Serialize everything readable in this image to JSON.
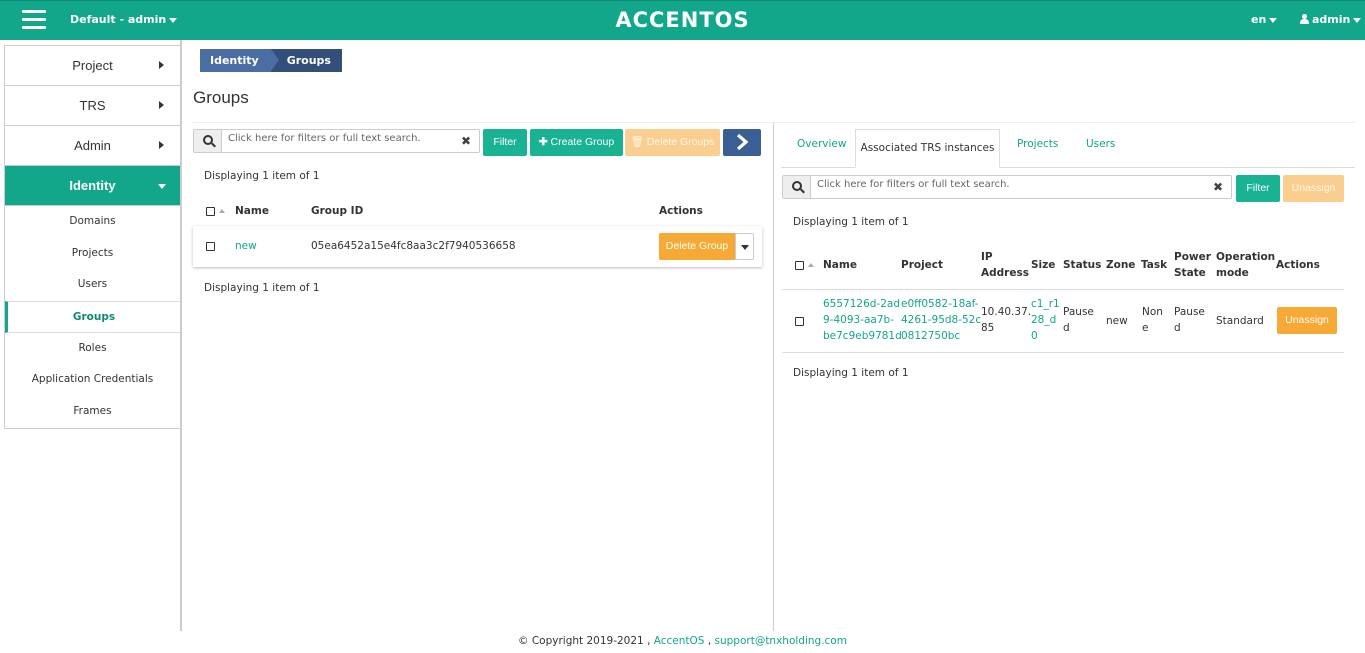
{
  "header": {
    "context": "Default - admin",
    "logo": "ACCENTOS",
    "language": "en",
    "user": "admin"
  },
  "sidebar": {
    "sections": [
      {
        "label": "Project"
      },
      {
        "label": "TRS"
      },
      {
        "label": "Admin"
      },
      {
        "label": "Identity"
      }
    ],
    "identity_items": [
      "Domains",
      "Projects",
      "Users",
      "Groups",
      "Roles",
      "Application Credentials",
      "Frames"
    ]
  },
  "breadcrumb": {
    "parent": "Identity",
    "current": "Groups"
  },
  "page_title": "Groups",
  "left": {
    "search_placeholder": "Click here for filters or full text search.",
    "filter_label": "Filter",
    "create_label": "Create Group",
    "delete_label": "Delete Groups",
    "displaying_top": "Displaying 1 item of 1",
    "displaying_bottom": "Displaying 1 item of 1",
    "columns": {
      "name": "Name",
      "group_id": "Group ID",
      "actions": "Actions"
    },
    "row": {
      "name": "new",
      "group_id": "05ea6452a15e4fc8aa3c2f7940536658",
      "action": "Delete Group"
    }
  },
  "right": {
    "tabs": {
      "overview": "Overview",
      "associated": "Associated TRS instances",
      "projects": "Projects",
      "users": "Users"
    },
    "search_placeholder": "Click here for filters or full text search.",
    "filter_label": "Filter",
    "unassign_label": "Unassign",
    "displaying_top": "Displaying 1 item of 1",
    "displaying_bottom": "Displaying 1 item of 1",
    "columns": {
      "name": "Name",
      "project": "Project",
      "ip1": "IP",
      "ip2": "Address",
      "size": "Size",
      "status": "Status",
      "zone": "Zone",
      "task": "Task",
      "power1": "Power",
      "power2": "State",
      "op1": "Operation",
      "op2": "mode",
      "actions": "Actions"
    },
    "row": {
      "name": [
        "6557126d-2ad",
        "9-4093-aa7b-",
        "be7c9eb9781d"
      ],
      "project": [
        "e0ff0582-18af-",
        "4261-95d8-52c",
        "0812750bc"
      ],
      "ip": [
        "10.40.37.",
        "85"
      ],
      "size": [
        "c1_r1",
        "28_d",
        "0"
      ],
      "status": [
        "Pause",
        "d"
      ],
      "zone": "new",
      "task": [
        "Non",
        "e"
      ],
      "power": [
        "Pause",
        "d"
      ],
      "operation_mode": "Standard",
      "action": "Unassign"
    }
  },
  "footer": {
    "copyright": "© Copyright 2019-2021 ,",
    "brand": "AccentOS",
    "sep": ",",
    "email": "support@tnxholding.com"
  }
}
